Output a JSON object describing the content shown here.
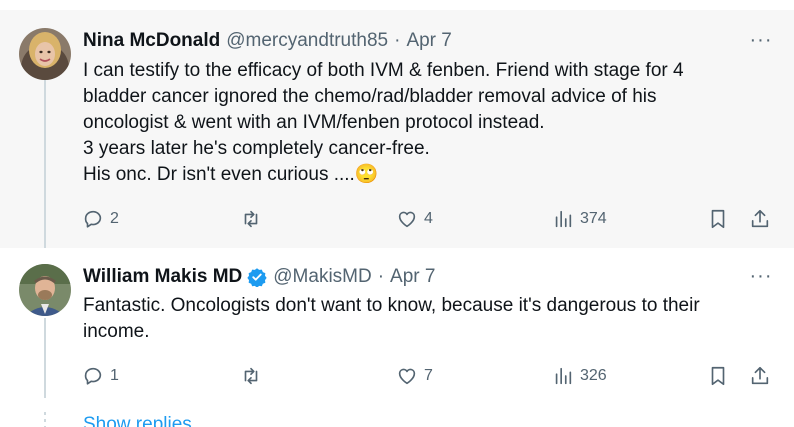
{
  "tweets": [
    {
      "name": "Nina McDonald",
      "handle": "@mercyandtruth85",
      "separator": "·",
      "date": "Apr 7",
      "verified": false,
      "more": "···",
      "lines": [
        "I can testify to the efficacy of both IVM & fenben. Friend with stage for 4",
        "bladder cancer ignored the chemo/rad/bladder removal advice of his",
        "oncologist & went with an IVM/fenben protocol instead.",
        "3 years later he's completely cancer-free.",
        "His onc. Dr isn't even curious ....🙄"
      ],
      "replies": "2",
      "retweets": "",
      "likes": "4",
      "views": "374"
    },
    {
      "name": "William Makis MD",
      "handle": "@MakisMD",
      "separator": "·",
      "date": "Apr 7",
      "verified": true,
      "more": "···",
      "lines": [
        "Fantastic. Oncologists don't want to know, because it's dangerous to their",
        "income."
      ],
      "replies": "1",
      "retweets": "",
      "likes": "7",
      "views": "326"
    }
  ],
  "show_replies": "Show replies",
  "colors": {
    "accent": "#1d9bf0",
    "muted": "#536471",
    "highlight_bg": "#f7f7f7",
    "verified": "#1d9bf0"
  },
  "icons": [
    "reply-icon",
    "retweet-icon",
    "like-icon",
    "views-icon",
    "bookmark-icon",
    "share-icon",
    "verified-badge-icon",
    "more-icon"
  ]
}
